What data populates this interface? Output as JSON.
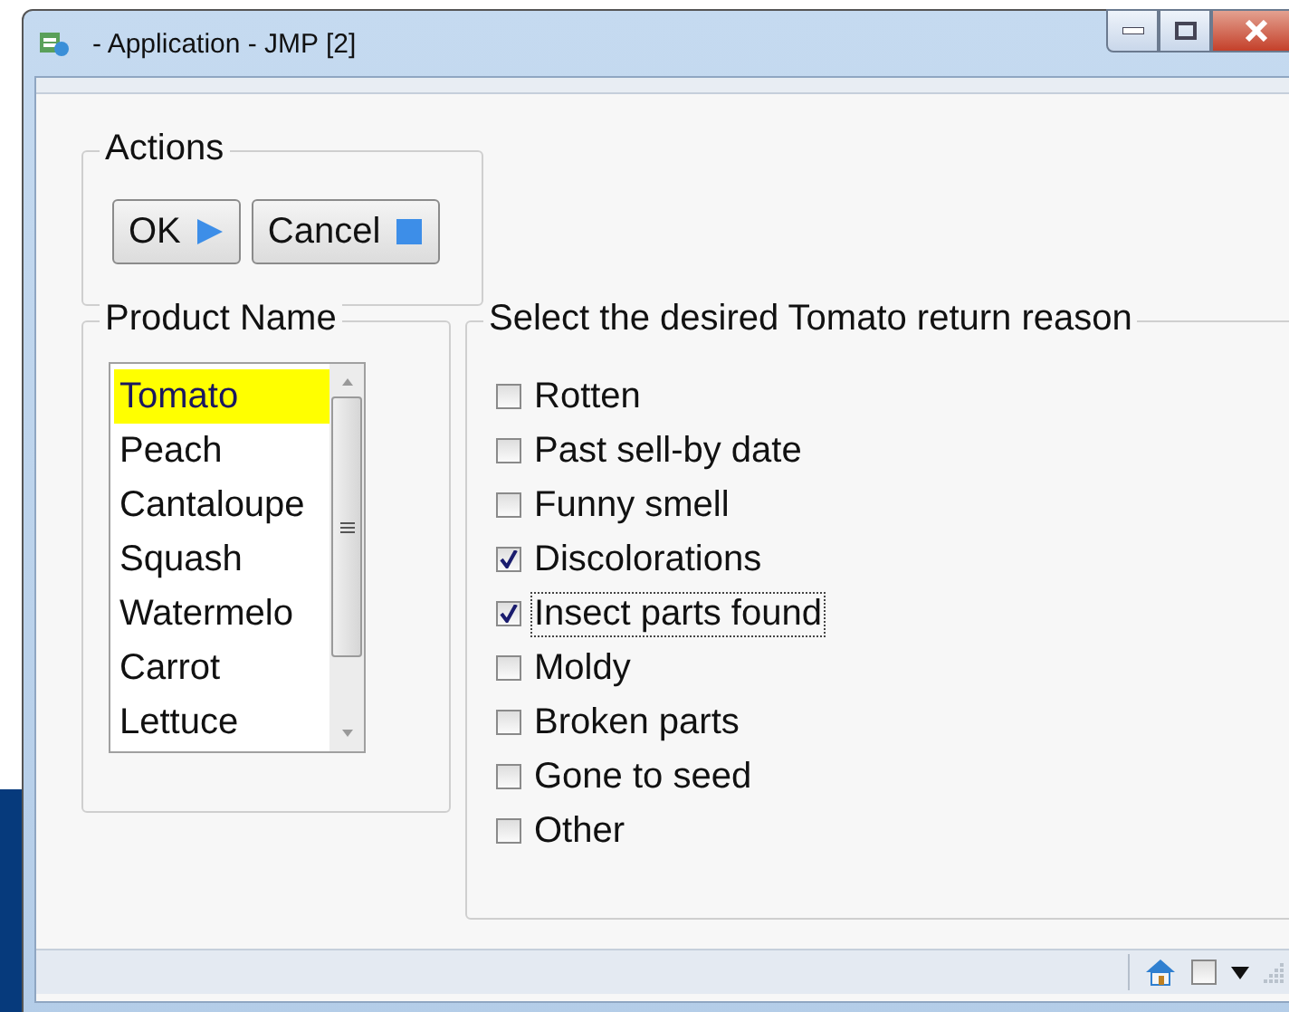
{
  "window": {
    "title": "- Application - JMP [2]"
  },
  "actions": {
    "title": "Actions",
    "buttons": [
      {
        "label": "OK",
        "kind": "play"
      },
      {
        "label": "Cancel",
        "kind": "stop"
      }
    ]
  },
  "product_name": {
    "title": "Product Name",
    "items": [
      {
        "label": "Tomato",
        "selected": true
      },
      {
        "label": "Peach",
        "selected": false
      },
      {
        "label": "Cantaloupe",
        "selected": false
      },
      {
        "label": "Squash",
        "selected": false
      },
      {
        "label": "Watermelo",
        "selected": false
      },
      {
        "label": "Carrot",
        "selected": false
      },
      {
        "label": "Lettuce",
        "selected": false
      }
    ]
  },
  "return_reason": {
    "title": "Select the desired Tomato return reason",
    "options": [
      {
        "label": "Rotten",
        "checked": false,
        "focused": false
      },
      {
        "label": "Past sell-by date",
        "checked": false,
        "focused": false
      },
      {
        "label": "Funny smell",
        "checked": false,
        "focused": false
      },
      {
        "label": "Discolorations",
        "checked": true,
        "focused": false
      },
      {
        "label": "Insect parts found",
        "checked": true,
        "focused": true
      },
      {
        "label": "Moldy",
        "checked": false,
        "focused": false
      },
      {
        "label": "Broken parts",
        "checked": false,
        "focused": false
      },
      {
        "label": "Gone to seed",
        "checked": false,
        "focused": false
      },
      {
        "label": "Other",
        "checked": false,
        "focused": false
      }
    ]
  },
  "status_bar": {
    "checkbox": {
      "checked": false
    }
  }
}
